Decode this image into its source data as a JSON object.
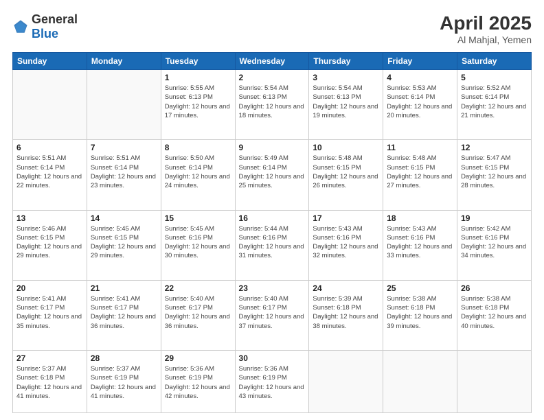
{
  "logo": {
    "general": "General",
    "blue": "Blue"
  },
  "header": {
    "month": "April 2025",
    "location": "Al Mahjal, Yemen"
  },
  "weekdays": [
    "Sunday",
    "Monday",
    "Tuesday",
    "Wednesday",
    "Thursday",
    "Friday",
    "Saturday"
  ],
  "weeks": [
    [
      {
        "day": "",
        "info": ""
      },
      {
        "day": "",
        "info": ""
      },
      {
        "day": "1",
        "info": "Sunrise: 5:55 AM\nSunset: 6:13 PM\nDaylight: 12 hours and 17 minutes."
      },
      {
        "day": "2",
        "info": "Sunrise: 5:54 AM\nSunset: 6:13 PM\nDaylight: 12 hours and 18 minutes."
      },
      {
        "day": "3",
        "info": "Sunrise: 5:54 AM\nSunset: 6:13 PM\nDaylight: 12 hours and 19 minutes."
      },
      {
        "day": "4",
        "info": "Sunrise: 5:53 AM\nSunset: 6:14 PM\nDaylight: 12 hours and 20 minutes."
      },
      {
        "day": "5",
        "info": "Sunrise: 5:52 AM\nSunset: 6:14 PM\nDaylight: 12 hours and 21 minutes."
      }
    ],
    [
      {
        "day": "6",
        "info": "Sunrise: 5:51 AM\nSunset: 6:14 PM\nDaylight: 12 hours and 22 minutes."
      },
      {
        "day": "7",
        "info": "Sunrise: 5:51 AM\nSunset: 6:14 PM\nDaylight: 12 hours and 23 minutes."
      },
      {
        "day": "8",
        "info": "Sunrise: 5:50 AM\nSunset: 6:14 PM\nDaylight: 12 hours and 24 minutes."
      },
      {
        "day": "9",
        "info": "Sunrise: 5:49 AM\nSunset: 6:14 PM\nDaylight: 12 hours and 25 minutes."
      },
      {
        "day": "10",
        "info": "Sunrise: 5:48 AM\nSunset: 6:15 PM\nDaylight: 12 hours and 26 minutes."
      },
      {
        "day": "11",
        "info": "Sunrise: 5:48 AM\nSunset: 6:15 PM\nDaylight: 12 hours and 27 minutes."
      },
      {
        "day": "12",
        "info": "Sunrise: 5:47 AM\nSunset: 6:15 PM\nDaylight: 12 hours and 28 minutes."
      }
    ],
    [
      {
        "day": "13",
        "info": "Sunrise: 5:46 AM\nSunset: 6:15 PM\nDaylight: 12 hours and 29 minutes."
      },
      {
        "day": "14",
        "info": "Sunrise: 5:45 AM\nSunset: 6:15 PM\nDaylight: 12 hours and 29 minutes."
      },
      {
        "day": "15",
        "info": "Sunrise: 5:45 AM\nSunset: 6:16 PM\nDaylight: 12 hours and 30 minutes."
      },
      {
        "day": "16",
        "info": "Sunrise: 5:44 AM\nSunset: 6:16 PM\nDaylight: 12 hours and 31 minutes."
      },
      {
        "day": "17",
        "info": "Sunrise: 5:43 AM\nSunset: 6:16 PM\nDaylight: 12 hours and 32 minutes."
      },
      {
        "day": "18",
        "info": "Sunrise: 5:43 AM\nSunset: 6:16 PM\nDaylight: 12 hours and 33 minutes."
      },
      {
        "day": "19",
        "info": "Sunrise: 5:42 AM\nSunset: 6:16 PM\nDaylight: 12 hours and 34 minutes."
      }
    ],
    [
      {
        "day": "20",
        "info": "Sunrise: 5:41 AM\nSunset: 6:17 PM\nDaylight: 12 hours and 35 minutes."
      },
      {
        "day": "21",
        "info": "Sunrise: 5:41 AM\nSunset: 6:17 PM\nDaylight: 12 hours and 36 minutes."
      },
      {
        "day": "22",
        "info": "Sunrise: 5:40 AM\nSunset: 6:17 PM\nDaylight: 12 hours and 36 minutes."
      },
      {
        "day": "23",
        "info": "Sunrise: 5:40 AM\nSunset: 6:17 PM\nDaylight: 12 hours and 37 minutes."
      },
      {
        "day": "24",
        "info": "Sunrise: 5:39 AM\nSunset: 6:18 PM\nDaylight: 12 hours and 38 minutes."
      },
      {
        "day": "25",
        "info": "Sunrise: 5:38 AM\nSunset: 6:18 PM\nDaylight: 12 hours and 39 minutes."
      },
      {
        "day": "26",
        "info": "Sunrise: 5:38 AM\nSunset: 6:18 PM\nDaylight: 12 hours and 40 minutes."
      }
    ],
    [
      {
        "day": "27",
        "info": "Sunrise: 5:37 AM\nSunset: 6:18 PM\nDaylight: 12 hours and 41 minutes."
      },
      {
        "day": "28",
        "info": "Sunrise: 5:37 AM\nSunset: 6:19 PM\nDaylight: 12 hours and 41 minutes."
      },
      {
        "day": "29",
        "info": "Sunrise: 5:36 AM\nSunset: 6:19 PM\nDaylight: 12 hours and 42 minutes."
      },
      {
        "day": "30",
        "info": "Sunrise: 5:36 AM\nSunset: 6:19 PM\nDaylight: 12 hours and 43 minutes."
      },
      {
        "day": "",
        "info": ""
      },
      {
        "day": "",
        "info": ""
      },
      {
        "day": "",
        "info": ""
      }
    ]
  ]
}
